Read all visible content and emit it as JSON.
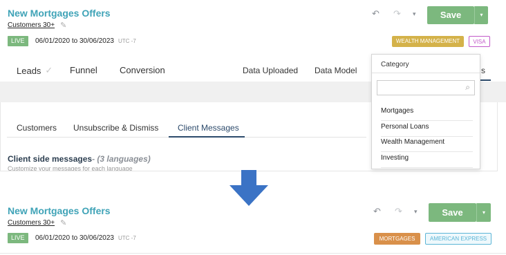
{
  "before": {
    "campaign": {
      "title": "New Mortgages Offers",
      "segment": "Customers 30+",
      "status": "LIVE",
      "dates": "06/01/2020 to 30/06/2023",
      "timezone": "UTC -7"
    },
    "toolbar": {
      "save_label": "Save"
    },
    "tags": [
      {
        "label": "WEALTH MANAGEMENT",
        "color": "#d4b24a"
      },
      {
        "label": "VISA",
        "color": "#c159c9"
      }
    ],
    "nav": {
      "left": [
        "Leads",
        "Funnel",
        "Conversion"
      ],
      "right": [
        "Data Uploaded",
        "Data Model"
      ],
      "hidden_tail": "s"
    },
    "subtabs": [
      "Customers",
      "Unsubscribe & Dismiss",
      "Client Messages"
    ],
    "client_side": {
      "title": "Client side messages",
      "subtitle": "- (3 languages)",
      "description": "Customize your messages for each language"
    },
    "category_dropdown": {
      "header": "Category",
      "search_placeholder": "",
      "items": [
        "Mortgages",
        "Personal Loans",
        "Wealth Management",
        "Investing"
      ]
    }
  },
  "after": {
    "campaign": {
      "title": "New Mortgages Offers",
      "segment": "Customers 30+",
      "status": "LIVE",
      "dates": "06/01/2020 to 30/06/2023",
      "timezone": "UTC -7"
    },
    "toolbar": {
      "save_label": "Save"
    },
    "tags": [
      {
        "label": "MORTGAGES",
        "color": "#d9904a"
      },
      {
        "label": "AMERICAN EXPRESS",
        "color": "#5bb5d6"
      }
    ]
  },
  "colors": {
    "title": "#3fa3b7",
    "live": "#7cb87e",
    "save": "#7cb87e",
    "arrow": "#3b73c5",
    "nav_active": "#2c4a6b"
  },
  "icons": [
    "undo-icon",
    "redo-icon",
    "caret-down-icon",
    "pencil-icon",
    "check-icon",
    "search-icon",
    "arrow-down-icon"
  ]
}
